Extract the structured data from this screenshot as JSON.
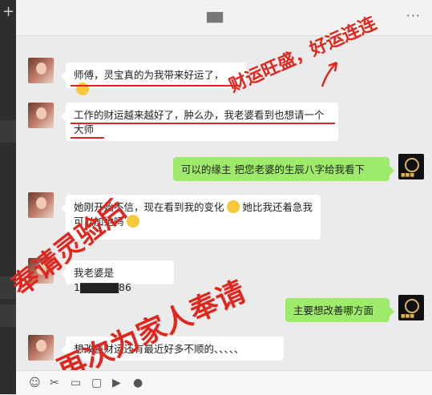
{
  "window": {
    "title": "▇▇",
    "more_icon": "more-dots-icon"
  },
  "sidebar": {
    "add_icon": "plus-icon"
  },
  "messages": [
    {
      "side": "left",
      "text": "师傅，灵宝真的为我带来好运了，",
      "emoji": "grin-emoji"
    },
    {
      "side": "left",
      "text": "工作的财运越来越好了，肿么办，我老婆看到也想请一个大师"
    },
    {
      "side": "right",
      "text": "可以的缘主 把您老婆的生辰八字给我看下"
    },
    {
      "side": "left",
      "text_a": "她刚开始不信，现在看到我的变化",
      "text_b": "她比我还着急我可以加她吗"
    },
    {
      "side": "left",
      "text": "我老婆是1▇▇▇▇▇86"
    },
    {
      "side": "right",
      "text": "主要想改善哪方面"
    },
    {
      "side": "left",
      "text": "想改善财运还有最近好多不顺的、、、、、"
    }
  ],
  "overlays": {
    "top_right": "财运旺盛，好运连连",
    "left_diagonal": "奉请灵验后",
    "center_diagonal": "再次为家人奉请"
  },
  "toolbar": {
    "icons": [
      "emoji-icon",
      "scissors-icon",
      "folder-icon",
      "chat-icon",
      "video-icon",
      "mic-icon"
    ]
  },
  "colors": {
    "accent_red": "#e0271f",
    "bubble_green": "#9eea6a"
  }
}
